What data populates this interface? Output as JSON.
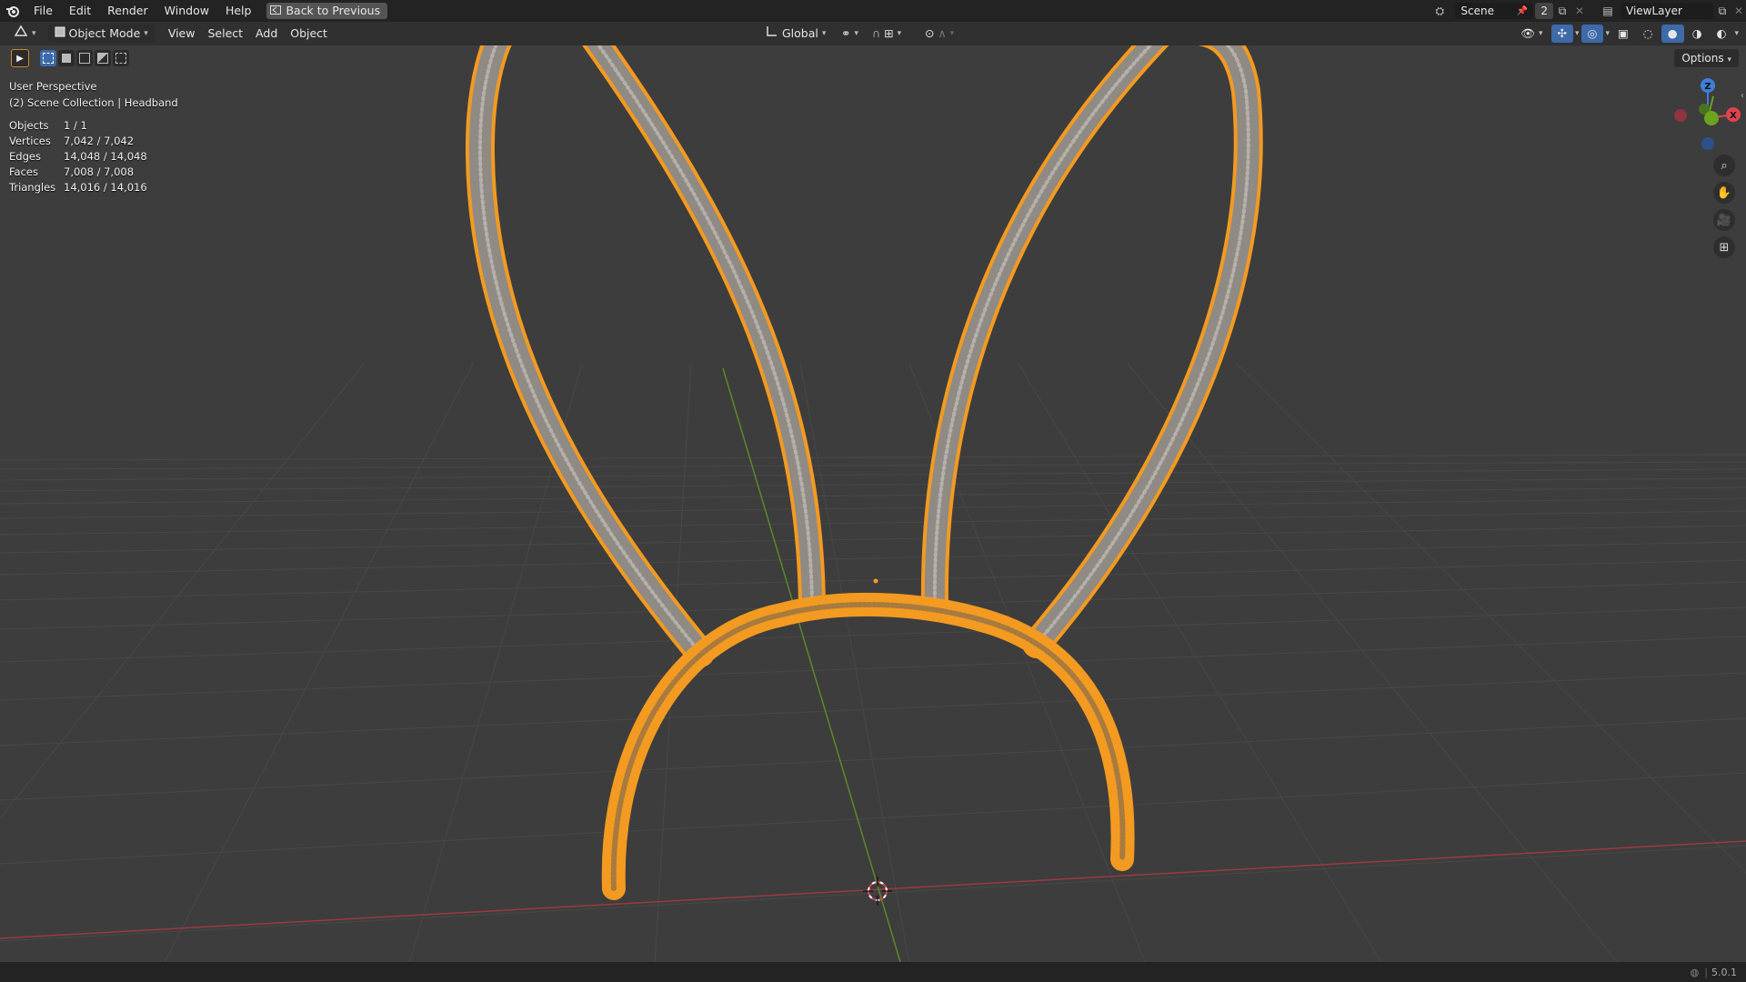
{
  "menu": {
    "items": [
      "File",
      "Edit",
      "Render",
      "Window",
      "Help"
    ],
    "back_label": "Back to Previous"
  },
  "topbar_right": {
    "scene_name": "Scene",
    "scene_users": "2",
    "view_layer": "ViewLayer"
  },
  "header": {
    "mode": "Object Mode",
    "menus": [
      "View",
      "Select",
      "Add",
      "Object"
    ],
    "transform_orientation": "Global",
    "options_label": "Options"
  },
  "overlay": {
    "perspective": "User Perspective",
    "collection": "(2) Scene Collection | Headband"
  },
  "stats": [
    {
      "key": "Objects",
      "value": "1 / 1"
    },
    {
      "key": "Vertices",
      "value": "7,042 / 7,042"
    },
    {
      "key": "Edges",
      "value": "14,048 / 14,048"
    },
    {
      "key": "Faces",
      "value": "7,008 / 7,008"
    },
    {
      "key": "Triangles",
      "value": "14,016 / 14,016"
    }
  ],
  "gizmo": {
    "z": "Z",
    "x": "X"
  },
  "status": {
    "version": "5.0.1"
  },
  "colors": {
    "selection": "#f39a21",
    "x_axis": "#e1434e",
    "y_axis": "#6ba31f",
    "z_axis": "#3f7fd9"
  }
}
